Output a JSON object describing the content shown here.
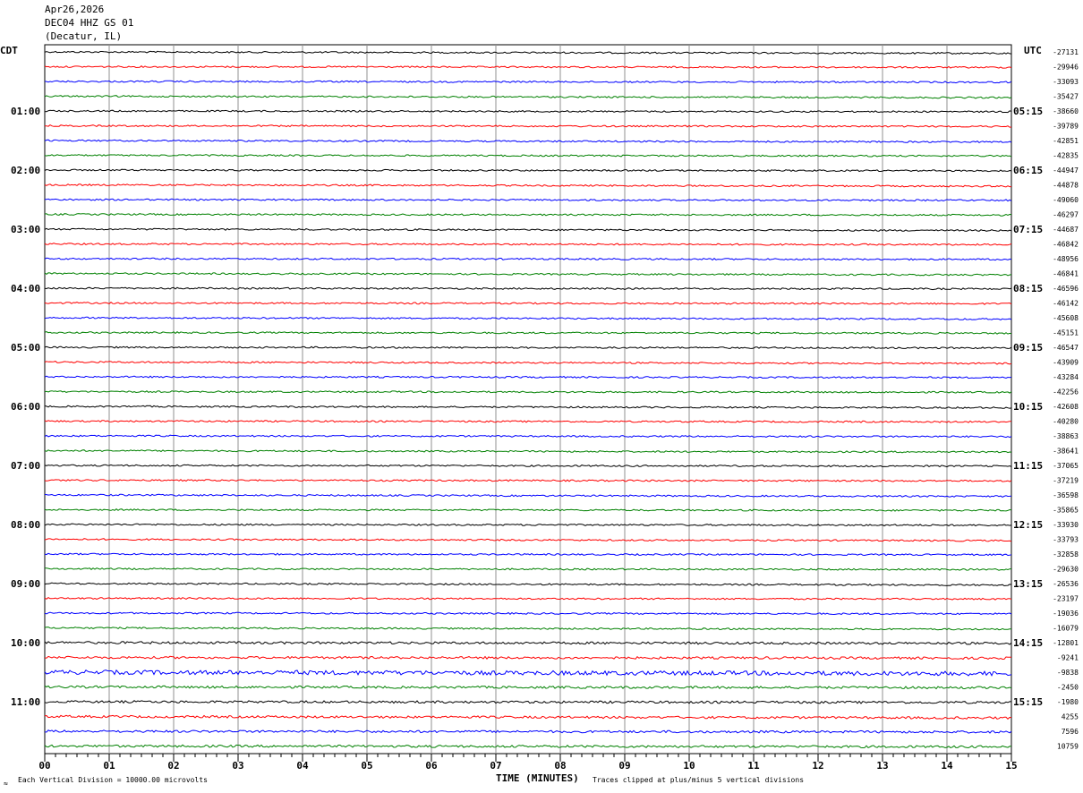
{
  "header": {
    "line1": "Apr26,2026",
    "line2": "DEC04 HHZ GS 01",
    "line3": "(Decatur, IL)"
  },
  "footer": {
    "left_note": "Each Vertical Division = 10000.00 microvolts",
    "xlabel": "TIME (MINUTES)",
    "right_note": "Traces clipped at plus/minus 5 vertical divisions"
  },
  "chart_data": {
    "type": "line",
    "title": "",
    "xlabel": "TIME (MINUTES)",
    "xlim": [
      0,
      15
    ],
    "x_ticks": [
      "00",
      "01",
      "02",
      "03",
      "04",
      "05",
      "06",
      "07",
      "08",
      "09",
      "10",
      "11",
      "12",
      "13",
      "14",
      "15"
    ],
    "left_axis_label": "CDT",
    "right_axis_label": "UTC",
    "left_hour_labels": [
      "01:00",
      "02:00",
      "03:00",
      "04:00",
      "05:00",
      "06:00",
      "07:00",
      "08:00",
      "09:00",
      "10:00",
      "11:00"
    ],
    "right_hour_labels": [
      "05:15",
      "06:15",
      "07:15",
      "08:15",
      "09:15",
      "10:15",
      "11:15",
      "12:15",
      "13:15",
      "14:15",
      "15:15"
    ],
    "trace_colors": [
      "#000000",
      "#ff0000",
      "#0000ff",
      "#008000"
    ],
    "grid": true,
    "trace_count": 48,
    "trace_offsets": [
      "-27131",
      "-29946",
      "-33093",
      "-35427",
      "-38660",
      "-39789",
      "-42851",
      "-42835",
      "-44947",
      "-44878",
      "-49060",
      "-46297",
      "-44687",
      "-46842",
      "-48956",
      "-46841",
      "-46596",
      "-46142",
      "-45608",
      "-45151",
      "-46547",
      "-43909",
      "-43284",
      "-42256",
      "-42608",
      "-40280",
      "-38863",
      "-38641",
      "-37065",
      "-37219",
      "-36598",
      "-35865",
      "-33930",
      "-33793",
      "-32858",
      "-29630",
      "-26536",
      "-23197",
      "-19036",
      "-16079",
      "-12801",
      "-9241",
      "-9838",
      "-2450",
      "-1980",
      "4255",
      "7596",
      "10759"
    ]
  }
}
